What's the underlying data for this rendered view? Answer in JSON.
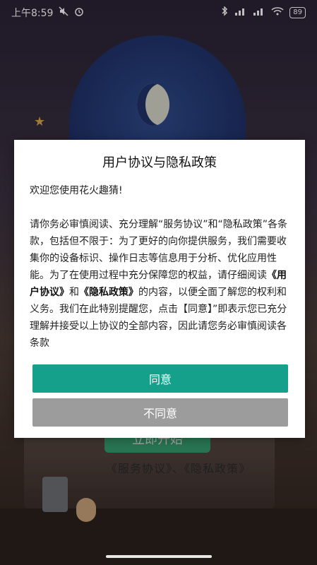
{
  "status_bar": {
    "time": "上午8:59",
    "battery": "89"
  },
  "background": {
    "start_button": "立即开始",
    "links_text": "《服务协议》、《隐私政策》"
  },
  "dialog": {
    "title": "用户协议与隐私政策",
    "greeting": "欢迎您使用花火趣猜!",
    "body": {
      "line1": "请你务必审慎阅读、充分理解“服务协议”和“隐私政策”各条款，包括但不限于：为了更好的向你提供服务，我们需要收集你的设备标识、操作日志等信息用于分析、优化应用性能。为了在使用过程中充分保障您的权益，请仔细阅读",
      "user_agreement": "《用户协议》",
      "and": "和",
      "privacy_policy": "《隐私政策》",
      "line2": "的内容，以便全面了解您的权利和义务。我们在此特别提醒您，点击【同意】”即表示您已充分理解并接受以上协议的全部内容，因此请您务必审慎阅读各条款"
    },
    "agree_label": "同意",
    "disagree_label": "不同意"
  },
  "colors": {
    "agree": "#14a08a",
    "disagree": "#9c9c9c"
  },
  "icons": [
    "silent-icon",
    "alarm-icon",
    "bluetooth-icon",
    "signal-icon",
    "wifi-icon",
    "battery-icon"
  ]
}
